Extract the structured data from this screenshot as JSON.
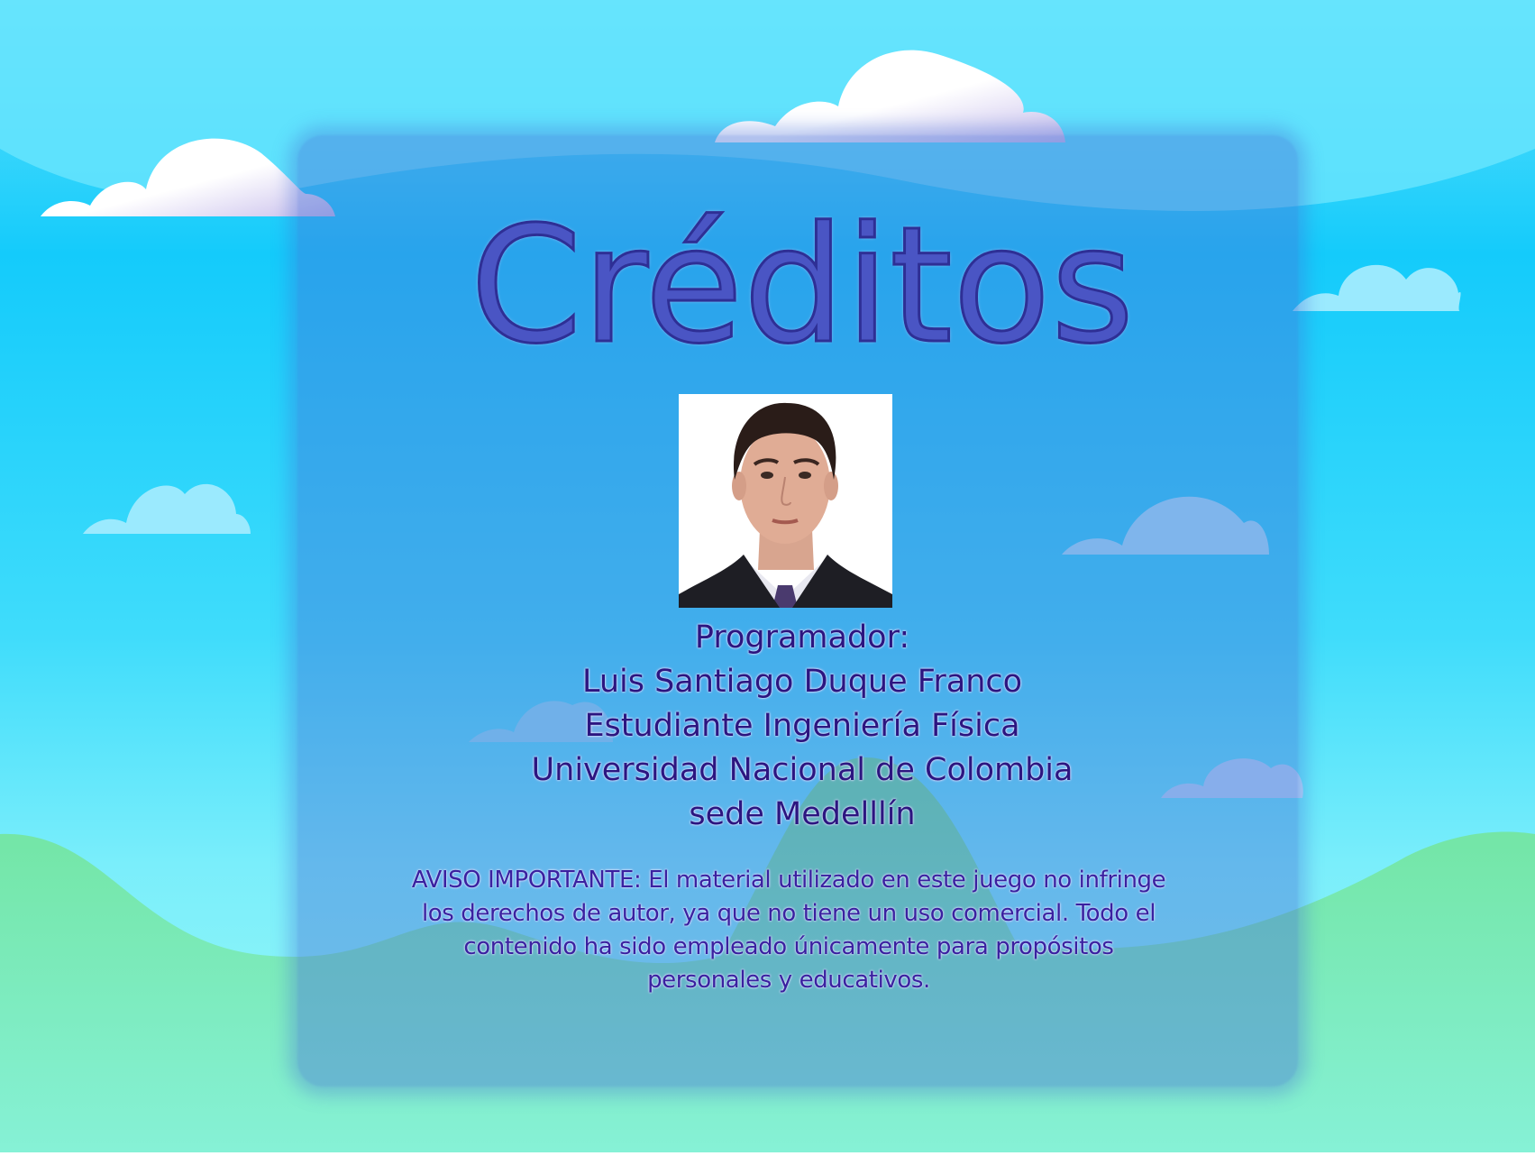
{
  "screen": {
    "title": "Créditos",
    "photo_alt": "Luis Santiago Duque Franco",
    "credits": {
      "line1": "Programador:",
      "line2": "Luis Santiago Duque Franco",
      "line3": "Estudiante Ingeniería Física",
      "line4": "Universidad Nacional de Colombia",
      "line5": "sede Medelllín"
    },
    "notice": {
      "line1": "AVISO IMPORTANTE:  El material utilizado en este juego no infringe",
      "line2": "los derechos de autor,  ya que no tiene un uso comercial.  Todo el",
      "line3": "contenido ha sido empleado únicamente para propósitos",
      "line4": "personales y educativos."
    }
  },
  "colors": {
    "sky_top": "#6ee3fb",
    "sky_mid": "#15cdfb",
    "ground": "#6fe6a0",
    "title": "#4a55c4",
    "text": "#2c1580"
  }
}
